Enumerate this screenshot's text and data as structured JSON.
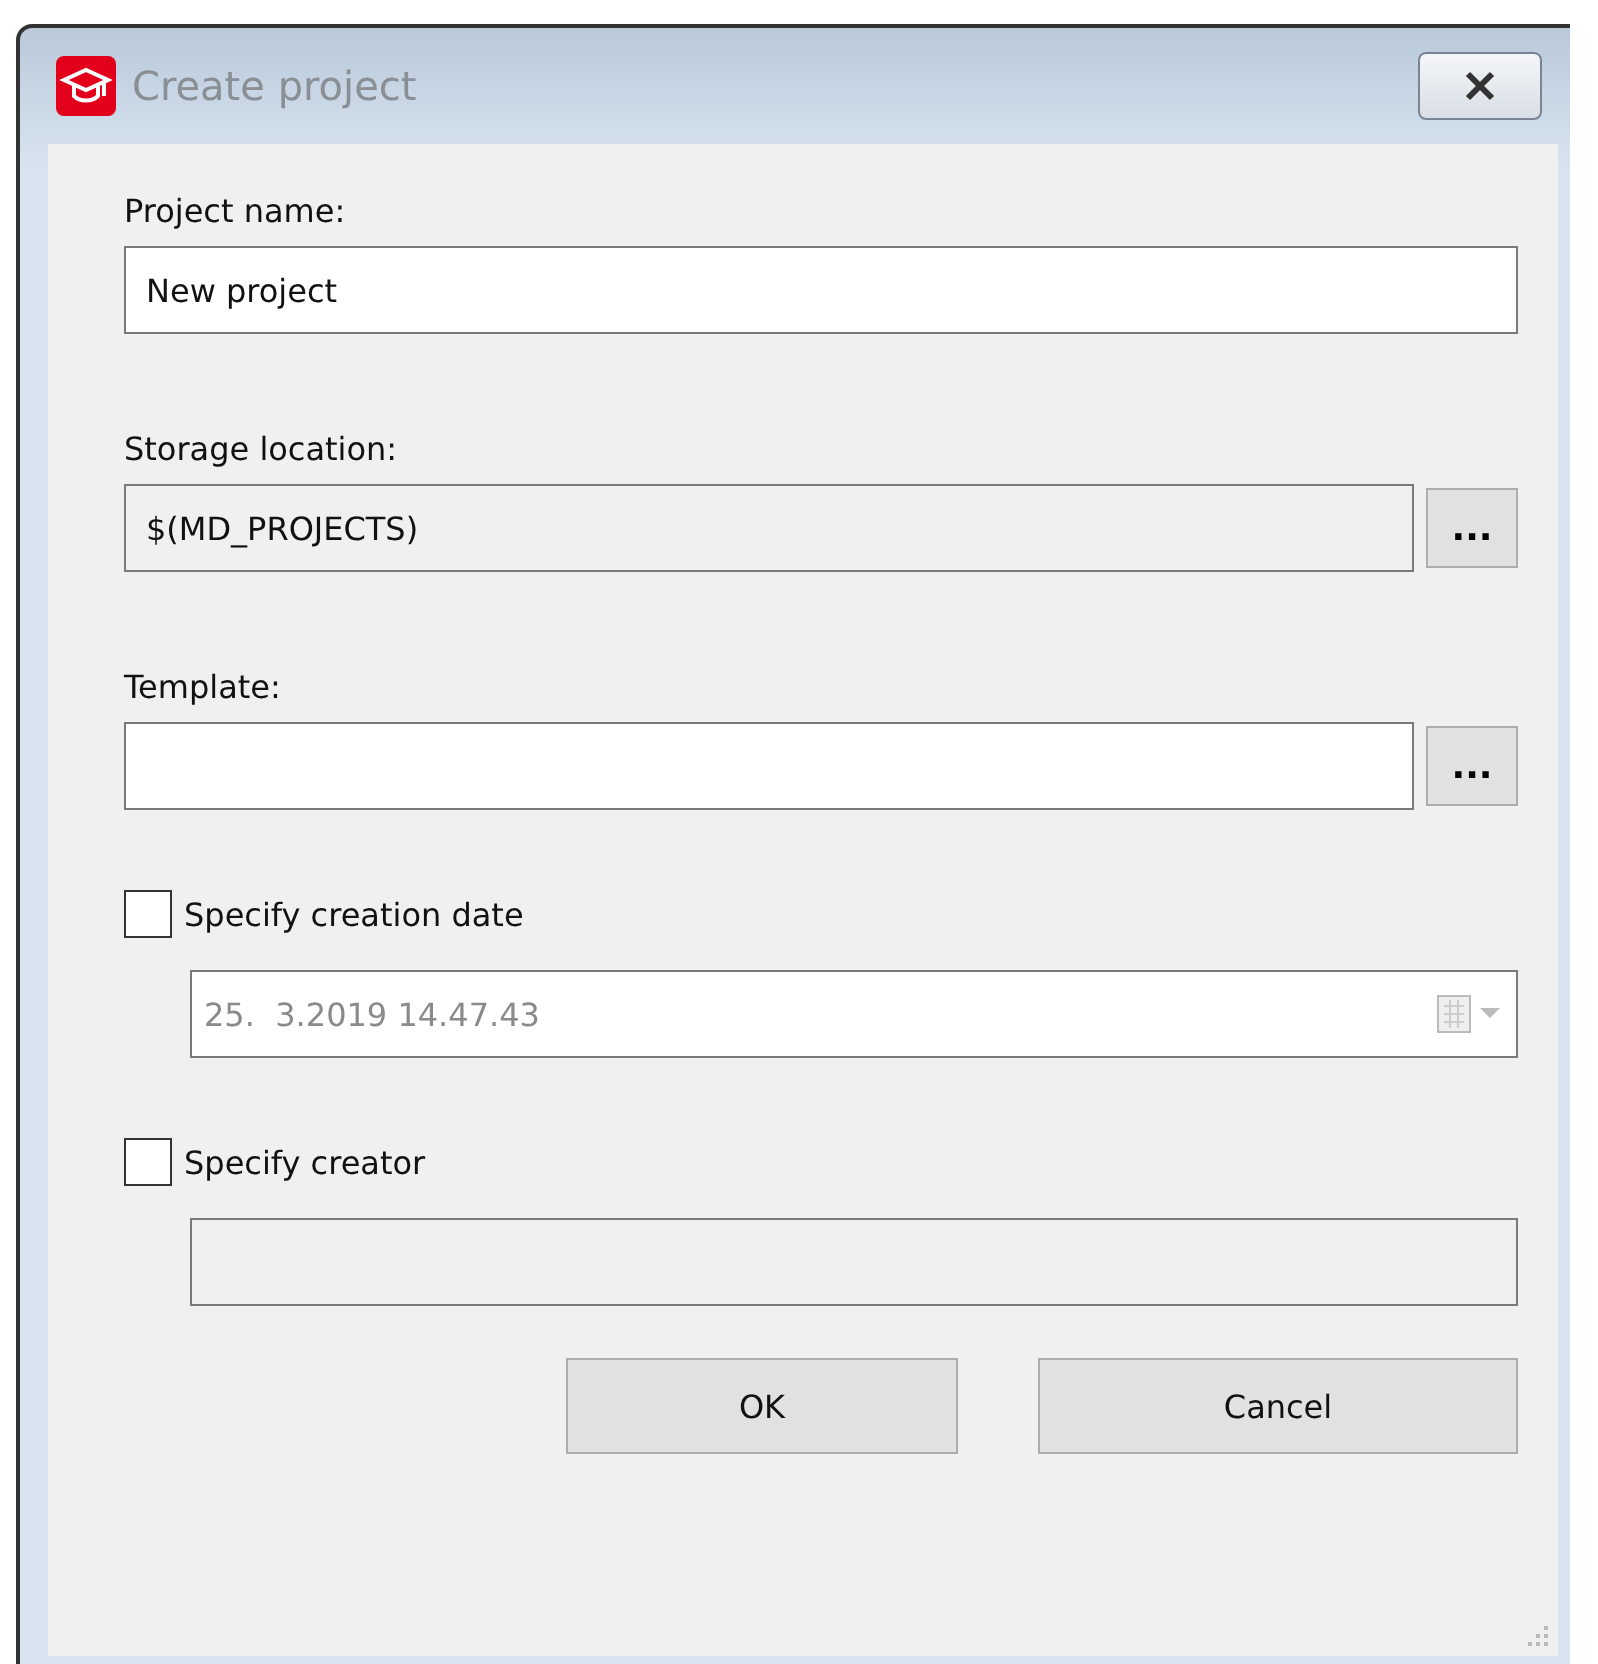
{
  "window": {
    "title": "Create project"
  },
  "fields": [
    {
      "label": "Project name:",
      "value": "New project",
      "readonly": false
    },
    {
      "label": "Storage location:",
      "value": "$(MD_PROJECTS)",
      "readonly": true,
      "browse_label": "..."
    },
    {
      "label": "Template:",
      "readonly": false,
      "browse_label": "..."
    }
  ],
  "options": [
    {
      "label": "Specify creation date",
      "checked": false,
      "kind": "date",
      "value": "25.  3.2019 14.47.43",
      "disabled": true
    },
    {
      "label": "Specify creator",
      "checked": false,
      "kind": "text",
      "disabled": true
    }
  ],
  "buttons": [
    "OK",
    "Cancel"
  ]
}
